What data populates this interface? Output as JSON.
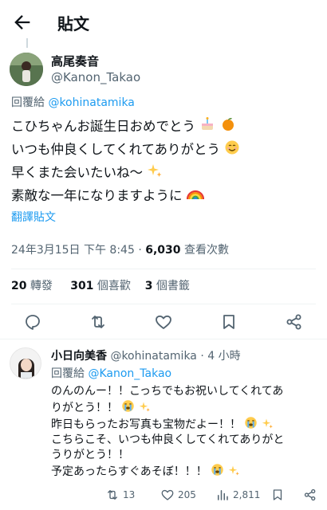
{
  "header": {
    "title": "貼文"
  },
  "tweet": {
    "author_name": "高尾奏音",
    "author_handle": "@Kanon_Takao",
    "replying_prefix": "回覆給",
    "replying_to": "@kohinatamika",
    "lines": [
      "こひちゃんお誕生日おめでとう",
      "いつも仲良くしてくれてありがとう",
      "早くまた会いたいね〜",
      "素敵な一年になりますように"
    ],
    "translate_label": "翻譯貼文",
    "timestamp": "24年3月15日 下午 8:45 · ",
    "views_count": "6,030",
    "views_label": " 查看次數",
    "reposts_count": "20",
    "reposts_label": " 轉發",
    "likes_count": "301",
    "likes_label": " 個喜歡",
    "bookmarks_count": "3",
    "bookmarks_label": " 個書籤"
  },
  "reply": {
    "author_name": "小日向美香",
    "author_handle": "@kohinatamika",
    "time": " · 4 小時",
    "replying_prefix": "回覆給",
    "replying_to": "@Kanon_Takao",
    "lines": [
      "のんのんー！！こっちでもお祝いしてくれてあ",
      "りがとう！！",
      "昨日もらったお写真も宝物だよー！！",
      "こちらこそ、いつも仲良くしてくれてありがと",
      "うりがとう！！",
      "予定あったらすぐあそぼ！！！"
    ],
    "comments_count": "13",
    "likes_count": "205",
    "views_count": "2,811"
  },
  "colors": {
    "accent": "#1d9bf0",
    "secondary_text": "#536471",
    "divider": "#eff3f4"
  }
}
